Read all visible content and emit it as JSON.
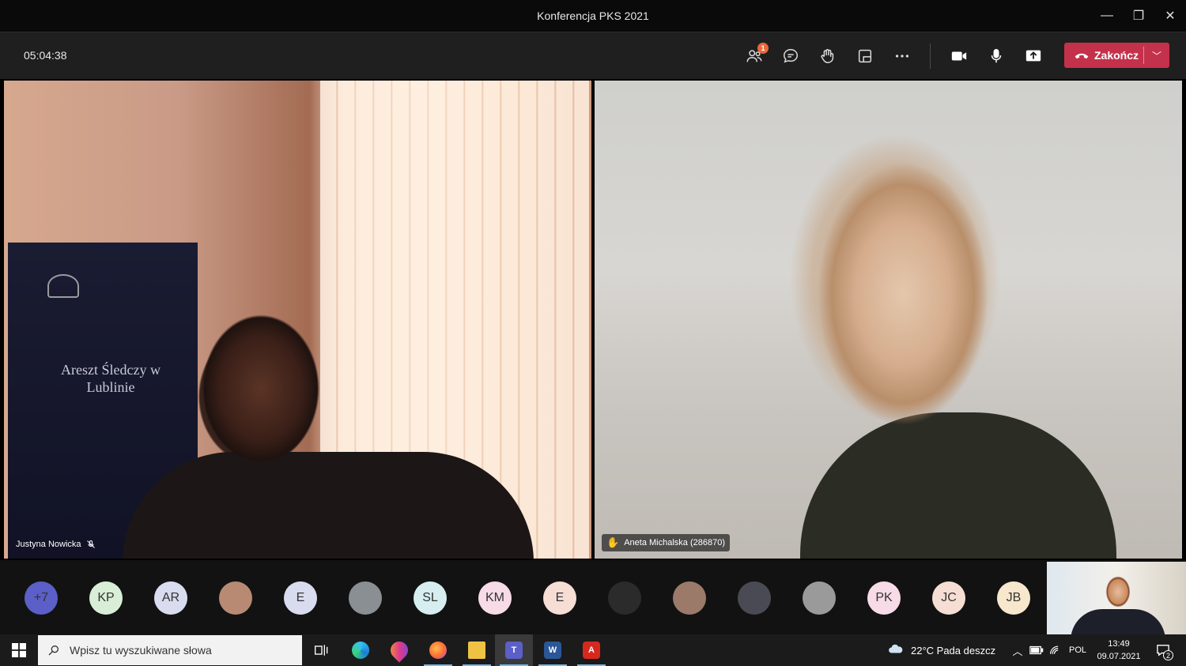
{
  "window": {
    "title": "Konferencja PKS 2021",
    "minimize_label": "—",
    "restore_label": "❐",
    "close_label": "✕"
  },
  "toolbar": {
    "timer": "05:04:38",
    "participants_badge": "1",
    "end_label": "Zakończ",
    "end_color": "#c4314b",
    "icons": [
      "participants-icon",
      "chat-icon",
      "raise-hand-icon",
      "rooms-icon",
      "more-icon",
      "camera-icon",
      "mic-icon",
      "share-icon"
    ]
  },
  "tiles": {
    "left": {
      "name": "Justyna Nowicka",
      "banner_text": "Areszt Śledczy w Lublinie"
    },
    "right": {
      "name": "Aneta Michalska (286870)"
    }
  },
  "participants": [
    {
      "label": "+7",
      "bg": "#5b5fc7"
    },
    {
      "label": "KP",
      "bg": "#d9eed7"
    },
    {
      "label": "AR",
      "bg": "#d9dbef"
    },
    {
      "label": "",
      "bg": "#b88a74"
    },
    {
      "label": "E",
      "bg": "#d9dbef"
    },
    {
      "label": "",
      "bg": "#8a8f94"
    },
    {
      "label": "SL",
      "bg": "#d6eef0"
    },
    {
      "label": "KM",
      "bg": "#f7dbe6"
    },
    {
      "label": "E",
      "bg": "#f6ded4"
    },
    {
      "label": "",
      "bg": "#2b2b2b"
    },
    {
      "label": "",
      "bg": "#9b7a6a"
    },
    {
      "label": "",
      "bg": "#4a4a55"
    },
    {
      "label": "",
      "bg": "#9a9a9a"
    },
    {
      "label": "PK",
      "bg": "#f7dbe6"
    },
    {
      "label": "JC",
      "bg": "#f6ded4"
    },
    {
      "label": "JB",
      "bg": "#f7e7cc"
    }
  ],
  "taskbar": {
    "search_placeholder": "Wpisz tu wyszukiwane słowa",
    "weather": "22°C  Pada deszcz",
    "language": "POL",
    "time": "13:49",
    "date": "09.07.2021",
    "notifications": "2"
  }
}
